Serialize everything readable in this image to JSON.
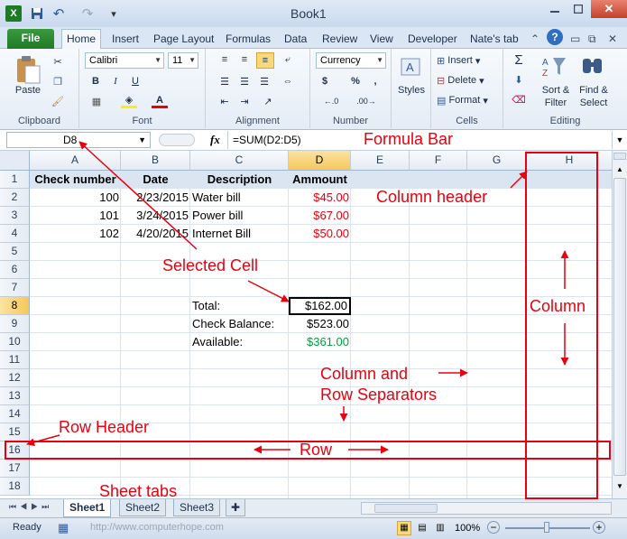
{
  "app": {
    "title": "Book1"
  },
  "qat": {
    "excel_icon": "X",
    "save_icon": "save-icon",
    "undo_icon": "↶",
    "redo_icon": "↷",
    "customize": "▾"
  },
  "tabs": [
    {
      "label": "File"
    },
    {
      "label": "Home"
    },
    {
      "label": "Insert"
    },
    {
      "label": "Page Layout"
    },
    {
      "label": "Formulas"
    },
    {
      "label": "Data"
    },
    {
      "label": "Review"
    },
    {
      "label": "View"
    },
    {
      "label": "Developer"
    },
    {
      "label": "Nate's tab"
    }
  ],
  "ribbon": {
    "clipboard": {
      "label": "Clipboard",
      "paste": "Paste"
    },
    "font": {
      "label": "Font",
      "name": "Calibri",
      "size": "11",
      "bold": "B",
      "italic": "I",
      "underline": "U",
      "grow": "A˄",
      "shrink": "A˅"
    },
    "alignment": {
      "label": "Alignment"
    },
    "number": {
      "label": "Number",
      "format": "Currency",
      "currency": "$",
      "percent": "%",
      "comma": ",",
      "inc_dec": "←.0",
      "dec_dec": ".00→"
    },
    "styles": {
      "label": "Styles"
    },
    "cells": {
      "label": "Cells",
      "insert": "Insert",
      "delete": "Delete",
      "format": "Format"
    },
    "editing": {
      "label": "Editing",
      "sigma": "Σ",
      "sort_1": "Sort &",
      "sort_2": "Filter",
      "find_1": "Find &",
      "find_2": "Select"
    }
  },
  "formula_bar": {
    "name_box": "D8",
    "fx": "fx",
    "formula": "=SUM(D2:D5)"
  },
  "columns": [
    "A",
    "B",
    "C",
    "D",
    "E",
    "F",
    "G",
    "H"
  ],
  "selected_column": "D",
  "rows": [
    "1",
    "2",
    "3",
    "4",
    "5",
    "6",
    "7",
    "8",
    "9",
    "10",
    "11",
    "12",
    "13",
    "14",
    "15",
    "16",
    "17",
    "18"
  ],
  "selected_row": "8",
  "cells": {
    "A1": "Check number",
    "B1": "Date",
    "C1": "Description",
    "D1": "Ammount",
    "A2": "100",
    "B2": "2/23/2015",
    "C2": "Water bill",
    "D2": "$45.00",
    "A3": "101",
    "B3": "3/24/2015",
    "C3": "Power bill",
    "D3": "$67.00",
    "A4": "102",
    "B4": "4/20/2015",
    "C4": "Internet Bill",
    "D4": "$50.00",
    "C8": "Total:",
    "D8": "$162.00",
    "C9": "Check Balance:",
    "D9": "$523.00",
    "C10": "Available:",
    "D10": "$361.00"
  },
  "sheet_tabs": [
    "Sheet1",
    "Sheet2",
    "Sheet3"
  ],
  "status": {
    "ready": "Ready",
    "zoom": "100%",
    "watermark": "http://www.computerhope.com"
  },
  "annotations": {
    "formula_bar": "Formula Bar",
    "column_header": "Column header",
    "selected_cell": "Selected Cell",
    "column": "Column",
    "separators_1": "Column and",
    "separators_2": "Row Separators",
    "row_header": "Row Header",
    "row": "Row",
    "sheet_tabs": "Sheet tabs"
  },
  "colors": {
    "annotation": "#e8000f",
    "file_tab": "#2a8a30",
    "selected_header": "#f6c85b",
    "negative": "#e0000f",
    "positive": "#00a040"
  }
}
